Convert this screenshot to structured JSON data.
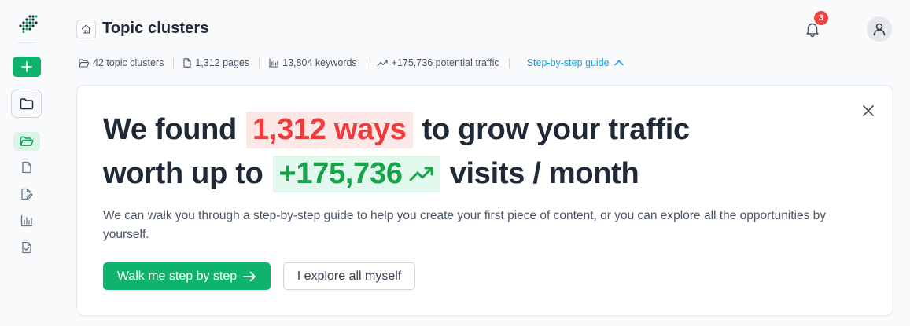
{
  "header": {
    "title": "Topic clusters",
    "notifications_count": "3"
  },
  "stats": [
    {
      "icon": "folder-icon",
      "label": "42 topic clusters"
    },
    {
      "icon": "file-icon",
      "label": "1,312 pages"
    },
    {
      "icon": "bar-chart-icon",
      "label": "13,804 keywords"
    },
    {
      "icon": "trending-up-icon",
      "label": "+175,736 potential traffic"
    }
  ],
  "guide_link": {
    "label": "Step-by-step guide",
    "icon": "chevron-up-icon"
  },
  "card": {
    "line1_pre": "We found",
    "line1_highlight": "1,312 ways",
    "line1_post": "to grow your traffic",
    "line2_pre": "worth up to",
    "line2_highlight": "+175,736",
    "line2_post": "visits / month",
    "description": "We can walk you through a step-by-step guide to help you create your first piece of content, or you can explore all the opportunities by yourself.",
    "primary_button": "Walk me step by step",
    "secondary_button": "I explore all myself"
  },
  "sidebar": {
    "items": [
      {
        "name": "sidebar-item-topic-clusters",
        "icon": "folder-open-icon",
        "active": true
      },
      {
        "name": "sidebar-item-pages",
        "icon": "file-icon",
        "active": false
      },
      {
        "name": "sidebar-item-editor",
        "icon": "file-edit-icon",
        "active": false
      },
      {
        "name": "sidebar-item-analytics",
        "icon": "bar-chart-icon",
        "active": false
      },
      {
        "name": "sidebar-item-checklist",
        "icon": "file-check-icon",
        "active": false
      }
    ]
  },
  "colors": {
    "accent_green": "#10b36b",
    "highlight_red": "#ef3b3b",
    "highlight_green": "#16a34a",
    "link_blue": "#0ea5e9",
    "badge_red": "#ef4444"
  }
}
